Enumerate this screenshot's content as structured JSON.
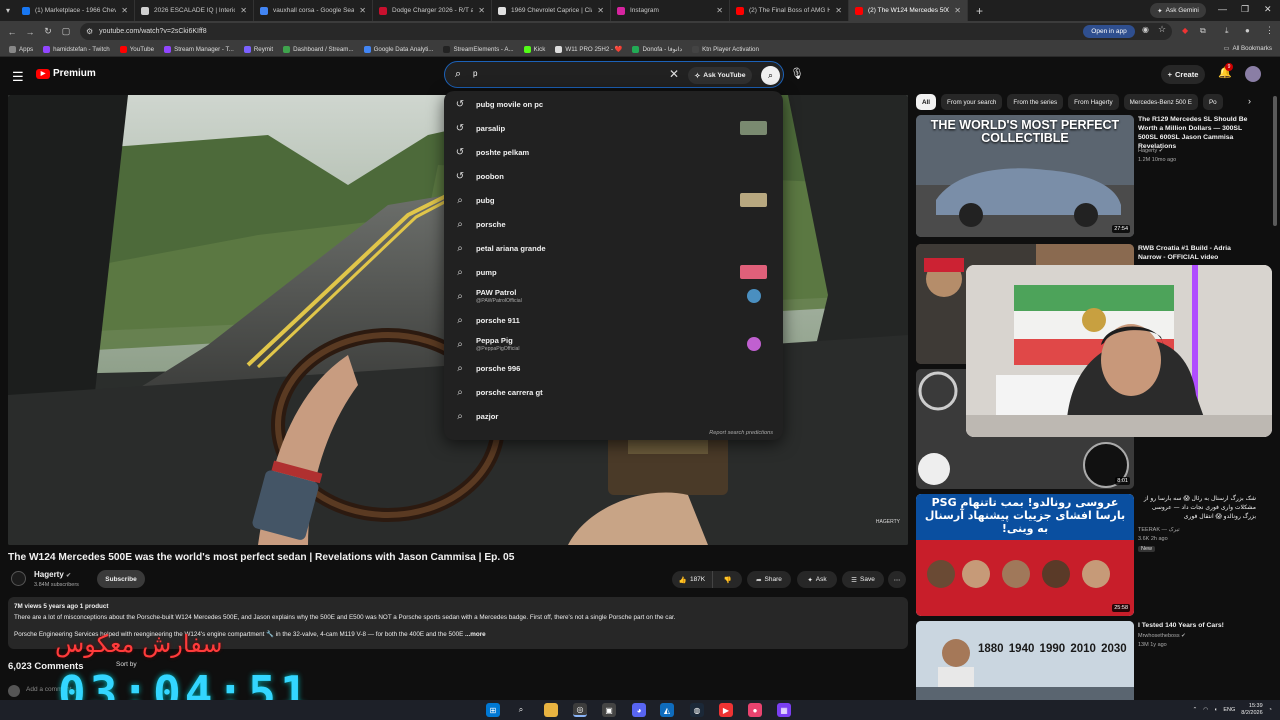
{
  "browser": {
    "tabs": [
      {
        "label": "(1) Marketplace - 1966 Chevrolet",
        "color": "#1877f2"
      },
      {
        "label": "2026 ESCALADE IQ | Interior Sc",
        "color": "#d0d0d0"
      },
      {
        "label": "vauxhall corsa - Google Search",
        "color": "#4285f4"
      },
      {
        "label": "Dodge Charger 2026 - R/T and",
        "color": "#c8102e"
      },
      {
        "label": "1969 Chevrolet Caprice | Classic",
        "color": "#e0e0e0"
      },
      {
        "label": "Instagram",
        "color": "#d6249f"
      },
      {
        "label": "(2) The Final Boss of AMG Hot",
        "color": "#ff0000"
      },
      {
        "label": "(2) The W124 Mercedes 500E",
        "color": "#ff0000",
        "active": true
      }
    ],
    "new_tab": "+",
    "ask_gemini": "Ask Gemini",
    "url": "youtube.com/watch?v=2sCki6KIff8",
    "open_in_app": "Open in app",
    "bookmarks": [
      {
        "label": "Apps",
        "color": "#888888"
      },
      {
        "label": "hamidstefan - Twitch",
        "color": "#9146ff"
      },
      {
        "label": "YouTube",
        "color": "#ff0000"
      },
      {
        "label": "Stream Manager - T...",
        "color": "#9146ff"
      },
      {
        "label": "Reymit",
        "color": "#7b61ff"
      },
      {
        "label": "Dashboard / Stream...",
        "color": "#3fa34d"
      },
      {
        "label": "Google Data Analyti...",
        "color": "#4285f4"
      },
      {
        "label": "StreamElements - A...",
        "color": "#222222"
      },
      {
        "label": "Kick",
        "color": "#53fc18"
      },
      {
        "label": "W11 PRO 25H2 - ❤️",
        "color": "#dddddd"
      },
      {
        "label": "Donofa - دانوفا",
        "color": "#22aa55"
      },
      {
        "label": "Ktn Player Activation",
        "color": "#444444"
      }
    ],
    "all_bookmarks": "All Bookmarks"
  },
  "youtube": {
    "logo": "Premium",
    "search_value": "p",
    "ask_youtube": "Ask YouTube",
    "create": "Create",
    "notif_count": "9"
  },
  "suggestions": [
    {
      "text": "pubg movile on pc",
      "type": "history"
    },
    {
      "text": "parsalip",
      "type": "history",
      "thumb": "#7a8a70"
    },
    {
      "text": "poshte pelkam",
      "type": "history"
    },
    {
      "text": "poobon",
      "type": "history"
    },
    {
      "text": "pubg",
      "type": "search",
      "thumb": "#b8a880"
    },
    {
      "text": "porsche",
      "type": "search"
    },
    {
      "text": "petal ariana grande",
      "type": "search"
    },
    {
      "text": "pump",
      "type": "search",
      "thumb": "#e0607a"
    },
    {
      "text": "PAW Patrol",
      "sub": "@PAWPatrolOfficial",
      "type": "search",
      "channel": "#4a8fc0"
    },
    {
      "text": "porsche 911",
      "type": "search"
    },
    {
      "text": "Peppa Pig",
      "sub": "@PeppaPigOfficial",
      "type": "search",
      "channel": "#c060d0"
    },
    {
      "text": "porsche 996",
      "type": "search"
    },
    {
      "text": "porsche carrera gt",
      "type": "search"
    },
    {
      "text": "pazjor",
      "type": "search"
    }
  ],
  "report": "Report search predictions",
  "watermark": "HAGERTY",
  "video": {
    "title": "The W124 Mercedes 500E was the world's most perfect sedan | Revelations with Jason Cammisa | Ep. 05",
    "channel": "Hagerty",
    "verified": "✔",
    "subscribers": "3.84M subscribers",
    "subscribe": "Subscribe",
    "likes": "187K",
    "share": "Share",
    "ask": "Ask",
    "save": "Save",
    "desc_meta": "7M views  5 years ago  1 product",
    "desc_line1": "There are a lot of misconceptions about the Porsche-built W124 Mercedes 500E, and Jason explains why the 500E and E500 was NOT a Porsche sports sedan with a Mercedes badge. First off, there's not a single Porsche part on the car.",
    "desc_line2": "Porsche Engineering Services helped with reengineering the W124's engine compartment 🔧 in the 32-valve, 4-cam M119 V-8 — for both the 400E and the 500E",
    "desc_more": " ...more",
    "comments": "6,023 Comments",
    "sort_by": "Sort by",
    "add_comment": "Add a comment..."
  },
  "overlay": {
    "text": "سفارش معکوس",
    "clock": "03:04:51"
  },
  "chips": [
    "All",
    "From your search",
    "From the series",
    "From Hagerty",
    "Mercedes-Benz 500 E",
    "Po"
  ],
  "recommendations": [
    {
      "title": "The R129 Mercedes SL Should Be Worth a Million Dollars — 300SL 500SL 600SL Jason Cammisa Revelations",
      "channel": "Hagerty ✔",
      "stats": "1.2M  10mo ago",
      "duration": "27:54",
      "thumb_text": "THE WORLD'S MOST PERFECT COLLECTIBLE"
    },
    {
      "title": "RWB Croatia #1 Build - Adria Narrow - OFFICIAL video",
      "channel": "",
      "stats": "",
      "duration": "",
      "thumb_text": ""
    },
    {
      "title": "",
      "channel": "",
      "stats": "",
      "duration": "8:01",
      "thumb_text": ""
    },
    {
      "title": "شک بزرگ ارسنال به رئال 😱 سه بارسا رو از مشکلات واری فوری نجات داد — عروسی بزرگ رونالدو 😱 انتقال فوری",
      "channel": "TEERAK — تیرک",
      "stats": "3.6K  2h ago",
      "duration": "25:58",
      "thumb_text": "عروسی رونالدو! بمب تاتنهام PSG بارسا افشای جزییات پیشنهاد آرسنال به وینی!",
      "badge": "New"
    },
    {
      "title": "I Tested 140 Years of Cars!",
      "channel": "Mrwhosetheboss ✔",
      "stats": "13M  1y ago",
      "duration": "",
      "thumb_text": "1880 1940 1990 2010 2030"
    }
  ],
  "taskbar": {
    "lang": "ENG",
    "time": "15:39",
    "date": "8/2/2026"
  }
}
